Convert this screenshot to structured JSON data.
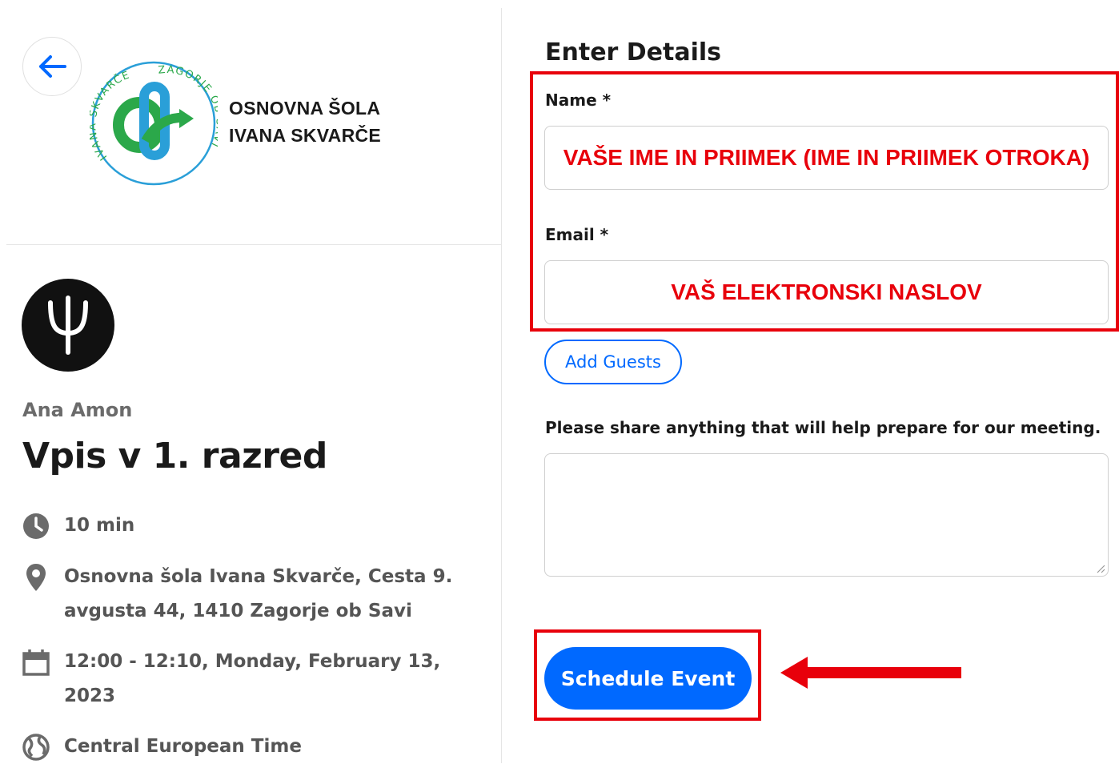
{
  "left": {
    "school": {
      "line1": "OSNOVNA ŠOLA",
      "line2": "IVANA SKVARČE",
      "emblem_text": "IVANA SKVARČE  ZAGORJE OB SAVI"
    },
    "host_name": "Ana Amon",
    "event_title": "Vpis v 1. razred",
    "details": [
      {
        "icon": "clock-icon",
        "text": "10 min"
      },
      {
        "icon": "location-pin-icon",
        "text": "Osnovna šola Ivana Skvarče, Cesta 9. avgusta 44, 1410 Zagorje ob Savi"
      },
      {
        "icon": "calendar-icon",
        "text": "12:00 - 12:10, Monday, February 13, 2023"
      },
      {
        "icon": "globe-icon",
        "text": "Central European Time"
      }
    ]
  },
  "form": {
    "title": "Enter Details",
    "name_label": "Name *",
    "name_value": "VAŠE IME IN PRIIMEK (IME IN PRIIMEK OTROKA)",
    "email_label": "Email *",
    "email_value": "VAŠ ELEKTRONSKI NASLOV",
    "add_guests_label": "Add Guests",
    "notes_label": "Please share anything that will help prepare for our meeting.",
    "notes_value": "",
    "submit_label": "Schedule Event"
  },
  "colors": {
    "accent": "#0069ff",
    "annotation": "#e8000b",
    "emblem_green": "#2ba84a",
    "emblem_blue": "#2a9fd8"
  }
}
